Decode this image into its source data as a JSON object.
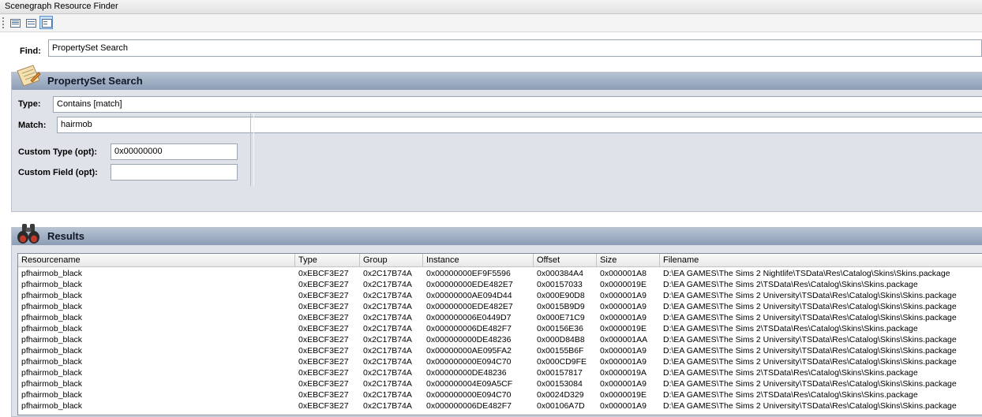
{
  "window": {
    "title": "Scenegraph Resource Finder"
  },
  "toolbar": {
    "buttons": [
      {
        "icon": "list-view-icon"
      },
      {
        "icon": "details-view-icon"
      },
      {
        "icon": "tile-view-icon",
        "selected": true
      }
    ]
  },
  "find": {
    "label": "Find:",
    "value": "PropertySet Search"
  },
  "search_panel": {
    "title": "PropertySet Search",
    "icon": "property-search-icon",
    "type_label": "Type:",
    "type_value": "Contains [match]",
    "match_label": "Match:",
    "match_value": "hairmob",
    "custom_type_label": "Custom Type (opt):",
    "custom_type_value": "0x00000000",
    "custom_field_label": "Custom Field (opt):",
    "custom_field_value": ""
  },
  "results_panel": {
    "title": "Results",
    "icon": "binoculars-icon",
    "columns": [
      "Resourcename",
      "Type",
      "Group",
      "Instance",
      "Offset",
      "Size",
      "Filename"
    ],
    "rows": [
      [
        "pfhairmob_black",
        "0xEBCF3E27",
        "0x2C17B74A",
        "0x00000000EF9F5596",
        "0x000384A4",
        "0x000001A8",
        "D:\\EA GAMES\\The Sims 2 Nightlife\\TSData\\Res\\Catalog\\Skins\\Skins.package"
      ],
      [
        "pfhairmob_black",
        "0xEBCF3E27",
        "0x2C17B74A",
        "0x00000000EDE482E7",
        "0x00157033",
        "0x0000019E",
        "D:\\EA GAMES\\The Sims 2\\TSData\\Res\\Catalog\\Skins\\Skins.package"
      ],
      [
        "pfhairmob_black",
        "0xEBCF3E27",
        "0x2C17B74A",
        "0x00000000AE094D44",
        "0x000E90D8",
        "0x000001A9",
        "D:\\EA GAMES\\The Sims 2 University\\TSData\\Res\\Catalog\\Skins\\Skins.package"
      ],
      [
        "pfhairmob_black",
        "0xEBCF3E27",
        "0x2C17B74A",
        "0x00000000EDE482E7",
        "0x0015B9D9",
        "0x000001A9",
        "D:\\EA GAMES\\The Sims 2 University\\TSData\\Res\\Catalog\\Skins\\Skins.package"
      ],
      [
        "pfhairmob_black",
        "0xEBCF3E27",
        "0x2C17B74A",
        "0x000000006E0449D7",
        "0x000E71C9",
        "0x000001A9",
        "D:\\EA GAMES\\The Sims 2 University\\TSData\\Res\\Catalog\\Skins\\Skins.package"
      ],
      [
        "pfhairmob_black",
        "0xEBCF3E27",
        "0x2C17B74A",
        "0x000000006DE482F7",
        "0x00156E36",
        "0x0000019E",
        "D:\\EA GAMES\\The Sims 2\\TSData\\Res\\Catalog\\Skins\\Skins.package"
      ],
      [
        "pfhairmob_black",
        "0xEBCF3E27",
        "0x2C17B74A",
        "0x000000000DE48236",
        "0x000D84B8",
        "0x000001AA",
        "D:\\EA GAMES\\The Sims 2 University\\TSData\\Res\\Catalog\\Skins\\Skins.package"
      ],
      [
        "pfhairmob_black",
        "0xEBCF3E27",
        "0x2C17B74A",
        "0x00000000AE095FA2",
        "0x00155B6F",
        "0x000001A9",
        "D:\\EA GAMES\\The Sims 2 University\\TSData\\Res\\Catalog\\Skins\\Skins.package"
      ],
      [
        "pfhairmob_black",
        "0xEBCF3E27",
        "0x2C17B74A",
        "0x000000000E094C70",
        "0x000CD9FE",
        "0x000001A9",
        "D:\\EA GAMES\\The Sims 2 University\\TSData\\Res\\Catalog\\Skins\\Skins.package"
      ],
      [
        "pfhairmob_black",
        "0xEBCF3E27",
        "0x2C17B74A",
        "0x00000000DE48236",
        "0x00157817",
        "0x0000019A",
        "D:\\EA GAMES\\The Sims 2\\TSData\\Res\\Catalog\\Skins\\Skins.package"
      ],
      [
        "pfhairmob_black",
        "0xEBCF3E27",
        "0x2C17B74A",
        "0x000000004E09A5CF",
        "0x00153084",
        "0x000001A9",
        "D:\\EA GAMES\\The Sims 2 University\\TSData\\Res\\Catalog\\Skins\\Skins.package"
      ],
      [
        "pfhairmob_black",
        "0xEBCF3E27",
        "0x2C17B74A",
        "0x000000000E094C70",
        "0x0024D329",
        "0x0000019E",
        "D:\\EA GAMES\\The Sims 2\\TSData\\Res\\Catalog\\Skins\\Skins.package"
      ],
      [
        "pfhairmob_black",
        "0xEBCF3E27",
        "0x2C17B74A",
        "0x000000006DE482F7",
        "0x00106A7D",
        "0x000001A9",
        "D:\\EA GAMES\\The Sims 2 University\\TSData\\Res\\Catalog\\Skins\\Skins.package"
      ]
    ]
  }
}
